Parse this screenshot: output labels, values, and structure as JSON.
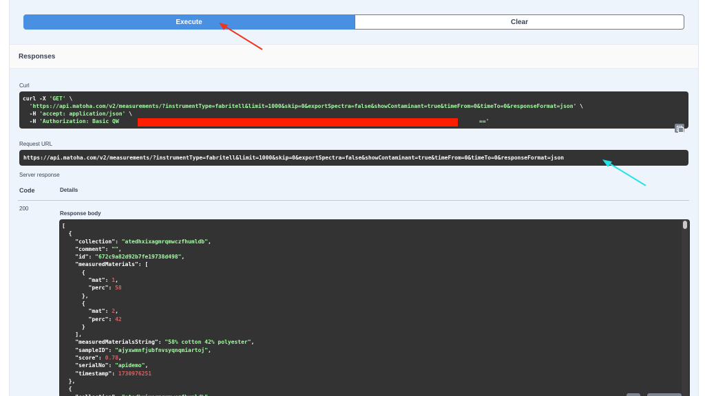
{
  "actions": {
    "execute_label": "Execute",
    "clear_label": "Clear"
  },
  "responses": {
    "title": "Responses"
  },
  "curl": {
    "label": "Curl",
    "lines": [
      [
        "curl -X ",
        "'GET'",
        " \\"
      ],
      [
        "  ",
        "'https://api.matoha.com/v2/measurements/?instrumentType=fabritell&limit=1000&skip=0&exportSpectra=false&showContaminant=true&timeFrom=0&timeTo=0&responseFormat=json'",
        " \\"
      ],
      [
        "  -H ",
        "'accept: application/json'",
        " \\"
      ],
      [
        "  -H ",
        "'Authorization: Basic QW",
        ""
      ]
    ],
    "line4_tail": "=='"
  },
  "request_url": {
    "label": "Request URL",
    "value": "https://api.matoha.com/v2/measurements/?instrumentType=fabritell&limit=1000&skip=0&exportSpectra=false&showContaminant=true&timeFrom=0&timeTo=0&responseFormat=json"
  },
  "server_response": {
    "label": "Server response",
    "code_header": "Code",
    "details_header": "Details",
    "code": "200",
    "body_label": "Response body"
  },
  "body_lines": [
    [
      [
        "p",
        "["
      ]
    ],
    [
      [
        "p",
        "  {"
      ]
    ],
    [
      [
        "p",
        "    "
      ],
      [
        "k",
        "\"collection\""
      ],
      [
        "p",
        ": "
      ],
      [
        "s",
        "\"atedhxixagmrqmwczfhumldb\""
      ],
      [
        "p",
        ","
      ]
    ],
    [
      [
        "p",
        "    "
      ],
      [
        "k",
        "\"comment\""
      ],
      [
        "p",
        ": "
      ],
      [
        "s",
        "\"\""
      ],
      [
        "p",
        ","
      ]
    ],
    [
      [
        "p",
        "    "
      ],
      [
        "k",
        "\"id\""
      ],
      [
        "p",
        ": "
      ],
      [
        "s",
        "\"672c9a82d92b7fe19738d498\""
      ],
      [
        "p",
        ","
      ]
    ],
    [
      [
        "p",
        "    "
      ],
      [
        "k",
        "\"measuredMaterials\""
      ],
      [
        "p",
        ": ["
      ]
    ],
    [
      [
        "p",
        "      {"
      ]
    ],
    [
      [
        "p",
        "        "
      ],
      [
        "k",
        "\"mat\""
      ],
      [
        "p",
        ": "
      ],
      [
        "n",
        "1"
      ],
      [
        "p",
        ","
      ]
    ],
    [
      [
        "p",
        "        "
      ],
      [
        "k",
        "\"perc\""
      ],
      [
        "p",
        ": "
      ],
      [
        "n",
        "58"
      ]
    ],
    [
      [
        "p",
        "      },"
      ]
    ],
    [
      [
        "p",
        "      {"
      ]
    ],
    [
      [
        "p",
        "        "
      ],
      [
        "k",
        "\"mat\""
      ],
      [
        "p",
        ": "
      ],
      [
        "n",
        "2"
      ],
      [
        "p",
        ","
      ]
    ],
    [
      [
        "p",
        "        "
      ],
      [
        "k",
        "\"perc\""
      ],
      [
        "p",
        ": "
      ],
      [
        "n",
        "42"
      ]
    ],
    [
      [
        "p",
        "      }"
      ]
    ],
    [
      [
        "p",
        "    ],"
      ]
    ],
    [
      [
        "p",
        "    "
      ],
      [
        "k",
        "\"measuredMaterialsString\""
      ],
      [
        "p",
        ": "
      ],
      [
        "s",
        "\"58% cotton 42% polyester\""
      ],
      [
        "p",
        ","
      ]
    ],
    [
      [
        "p",
        "    "
      ],
      [
        "k",
        "\"sampleID\""
      ],
      [
        "p",
        ": "
      ],
      [
        "s",
        "\"ajyxwmnfjubfnvsyqnqmiartoj\""
      ],
      [
        "p",
        ","
      ]
    ],
    [
      [
        "p",
        "    "
      ],
      [
        "k",
        "\"score\""
      ],
      [
        "p",
        ": "
      ],
      [
        "n",
        "0.78"
      ],
      [
        "p",
        ","
      ]
    ],
    [
      [
        "p",
        "    "
      ],
      [
        "k",
        "\"serialNo\""
      ],
      [
        "p",
        ": "
      ],
      [
        "s",
        "\"apidemo\""
      ],
      [
        "p",
        ","
      ]
    ],
    [
      [
        "p",
        "    "
      ],
      [
        "k",
        "\"timestamp\""
      ],
      [
        "p",
        ": "
      ],
      [
        "n",
        "1730976251"
      ]
    ],
    [
      [
        "p",
        "  },"
      ]
    ],
    [
      [
        "p",
        "  {"
      ]
    ],
    [
      [
        "p",
        "    "
      ],
      [
        "k",
        "\"collection\""
      ],
      [
        "p",
        ": "
      ],
      [
        "s",
        "\"atedhxixagmrqmwczfhumldb\""
      ]
    ]
  ]
}
